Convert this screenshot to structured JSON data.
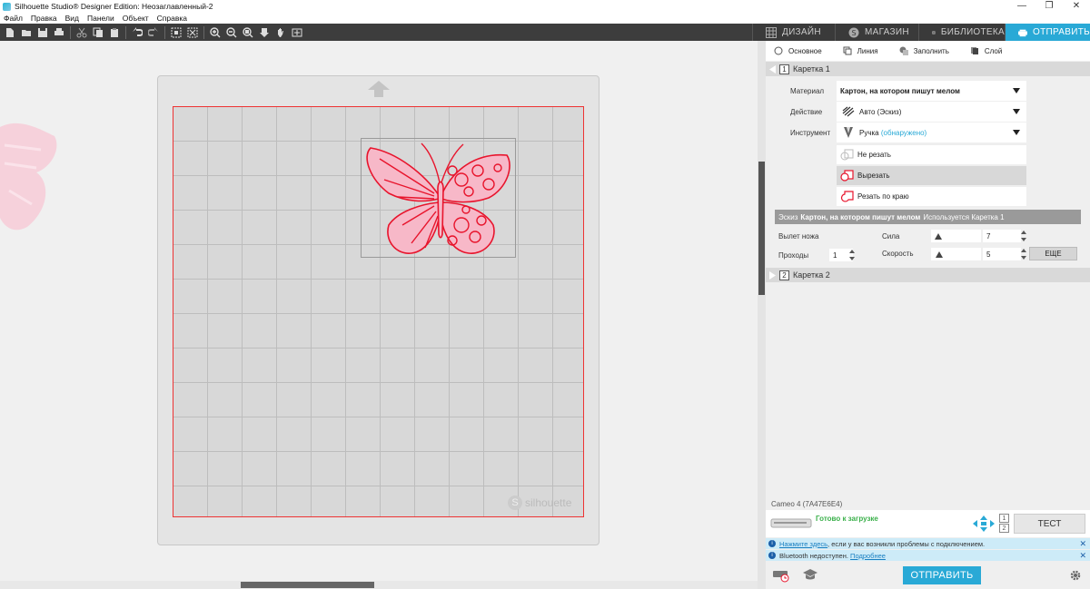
{
  "window": {
    "title": "Silhouette Studio® Designer Edition: Неозаглавленный-2",
    "minimize_glyph": "—",
    "restore_glyph": "❐",
    "close_glyph": "✕"
  },
  "menu": [
    "Файл",
    "Правка",
    "Вид",
    "Панели",
    "Объект",
    "Справка"
  ],
  "toolbar_icons": [
    "new-file-icon",
    "open-folder-icon",
    "save-icon",
    "print-icon",
    "cut-icon",
    "copy-icon",
    "paste-icon",
    "undo-icon",
    "redo-icon",
    "select-all-icon",
    "deselect-icon",
    "zoom-in-icon",
    "zoom-out-icon",
    "zoom-fit-icon",
    "move-down-icon",
    "pan-hand-icon",
    "fit-page-icon"
  ],
  "top_tabs": [
    {
      "label": "ДИЗАЙН",
      "icon": "grid-icon",
      "active": false
    },
    {
      "label": "МАГАЗИН",
      "icon": "store-icon",
      "active": false
    },
    {
      "label": "БИБЛИОТЕКА",
      "icon": "library-icon",
      "active": false
    },
    {
      "label": "ОТПРАВИТЬ",
      "icon": "send-icon",
      "active": true
    }
  ],
  "mode_tabs": [
    "Основное",
    "Линия",
    "Заполнить",
    "Слой"
  ],
  "carriage1": {
    "number": "1",
    "label": "Каретка 1",
    "material_label": "Материал",
    "material_value": "Картон, на котором пишут мелом",
    "action_label": "Действие",
    "action_value": "Авто (Эскиз)",
    "tool_label": "Инструмент",
    "tool_value": "Ручка",
    "tool_status": "(обнаружено)",
    "cut_options": [
      {
        "label": "Не резать",
        "selected": false
      },
      {
        "label": "Вырезать",
        "selected": true
      },
      {
        "label": "Резать по краю",
        "selected": false
      }
    ],
    "sketch_prefix": "Эскиз",
    "sketch_material": "Картон, на котором пишут мелом",
    "sketch_suffix": "Используется Каретка 1",
    "blade_label": "Вылет ножа",
    "passes_label": "Проходы",
    "passes_value": "1",
    "force_label": "Сила",
    "force_value": "7",
    "speed_label": "Скорость",
    "speed_value": "5",
    "more_label": "ЕЩЕ"
  },
  "carriage2": {
    "number": "2",
    "label": "Каретка 2"
  },
  "device": {
    "name": "Cameo 4 (7A47E6E4)",
    "status": "Готово к загрузке",
    "test_label": "ТЕСТ",
    "slot_numbers": [
      "1",
      "2"
    ]
  },
  "notices": [
    {
      "link": "Нажмите здесь",
      "text": ", если у вас возникли проблемы с подключением."
    },
    {
      "text": "Bluetooth недоступен.",
      "link": "Подробнее"
    }
  ],
  "send_button": "ОТПРАВИТЬ",
  "mat_brand": "silhouette",
  "colors": {
    "accent": "#29a9d6",
    "cut_red": "#e8142c",
    "pink_fill": "#f7b8c8",
    "ready_green": "#3ab04a"
  }
}
